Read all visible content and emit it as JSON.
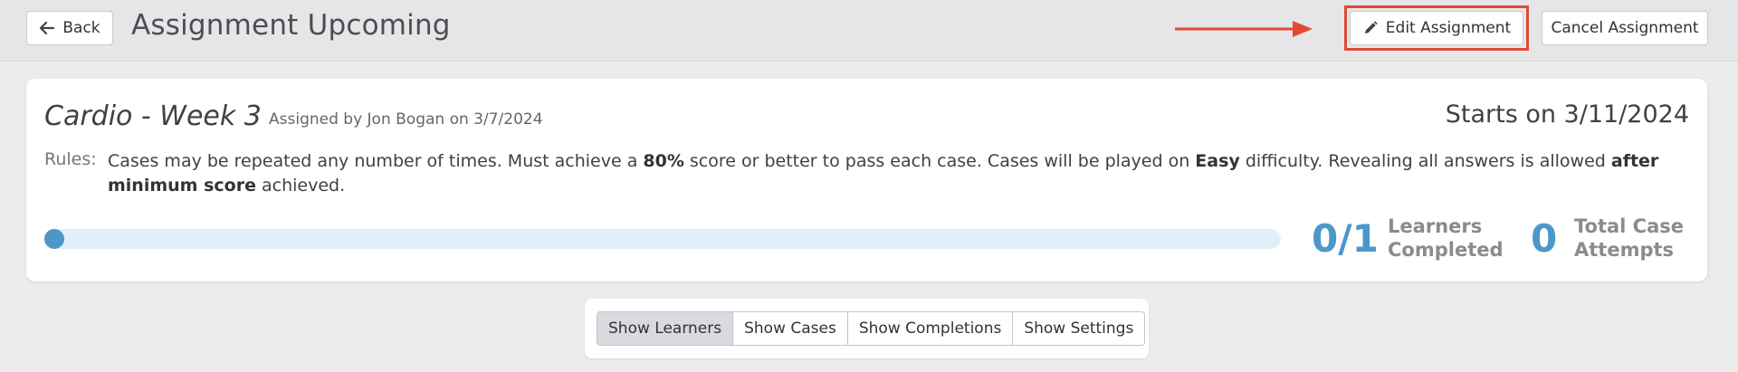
{
  "header": {
    "back_label": "Back",
    "title": "Assignment Upcoming",
    "edit_label": "Edit Assignment",
    "cancel_label": "Cancel Assignment",
    "annotation_color": "#e04a35"
  },
  "assignment": {
    "name": "Cardio - Week 3",
    "assigned_by": "Assigned by Jon Bogan on 3/7/2024",
    "starts_on": "Starts on 3/11/2024",
    "rules_label": "Rules:",
    "rules": {
      "p1": "Cases may be repeated any number of times. Must achieve a ",
      "b1": "80%",
      "p2": " score or better to pass each case. Cases will be played on ",
      "b2": "Easy",
      "p3": " difficulty. Revealing all answers is allowed ",
      "b3": "after minimum score",
      "p4": " achieved."
    },
    "progress": 0
  },
  "stats": {
    "learners_completed": "0/1",
    "learners_label_1": "Learners",
    "learners_label_2": "Completed",
    "total_attempts": "0",
    "attempts_label_1": "Total Case",
    "attempts_label_2": "Attempts"
  },
  "tabs": [
    {
      "label": "Show Learners",
      "active": true
    },
    {
      "label": "Show Cases",
      "active": false
    },
    {
      "label": "Show Completions",
      "active": false
    },
    {
      "label": "Show Settings",
      "active": false
    }
  ],
  "colors": {
    "accent": "#4b98c8",
    "track": "#e1eff8"
  }
}
